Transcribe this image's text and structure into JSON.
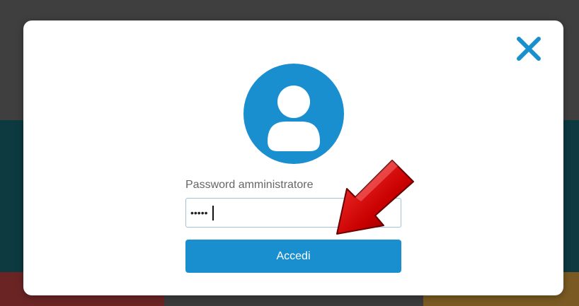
{
  "login_dialog": {
    "close_icon": "close-icon",
    "avatar_icon": "user-avatar-icon",
    "password_label": "Password amministratore",
    "password_value": "•••••",
    "submit_label": "Accedi"
  },
  "annotation": {
    "arrow_icon": "pointer-arrow-icon"
  },
  "colors": {
    "accent": "#1a8fd0",
    "overlay_dark": "#3f3f3f",
    "arrow_red": "#c80000"
  }
}
